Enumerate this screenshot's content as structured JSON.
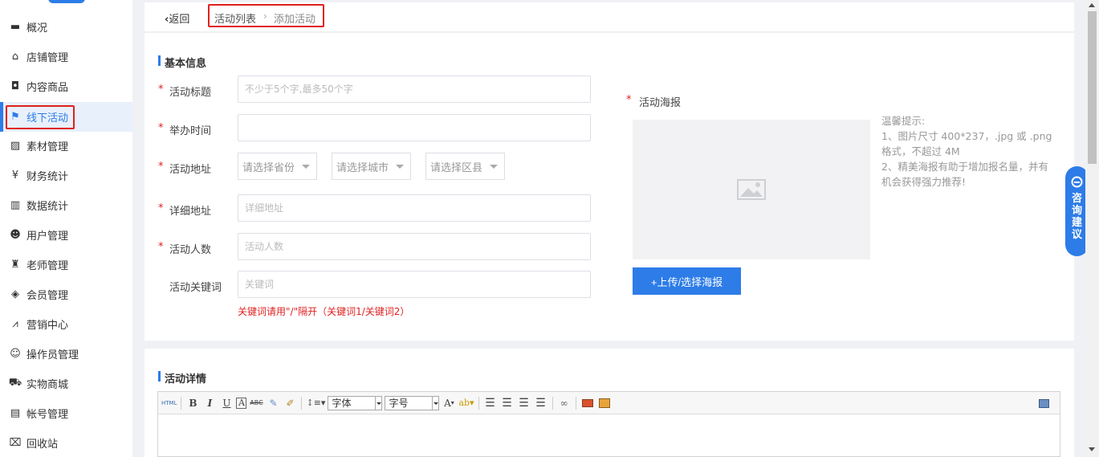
{
  "sidebar": {
    "items": [
      {
        "label": "概况",
        "icon": "overview-icon",
        "glyph": "▬"
      },
      {
        "label": "店铺管理",
        "icon": "shop-icon",
        "glyph": "⌂"
      },
      {
        "label": "内容商品",
        "icon": "bag-icon",
        "glyph": "◘"
      },
      {
        "label": "线下活动",
        "icon": "flag-icon",
        "glyph": "⚑"
      },
      {
        "label": "素材管理",
        "icon": "image-icon",
        "glyph": "▨"
      },
      {
        "label": "财务统计",
        "icon": "yen-icon",
        "glyph": "¥"
      },
      {
        "label": "数据统计",
        "icon": "bar-chart-icon",
        "glyph": "▥"
      },
      {
        "label": "用户管理",
        "icon": "user-icon",
        "glyph": "☻"
      },
      {
        "label": "老师管理",
        "icon": "teacher-icon",
        "glyph": "♜"
      },
      {
        "label": "会员管理",
        "icon": "diamond-icon",
        "glyph": "◈"
      },
      {
        "label": "营销中心",
        "icon": "trend-icon",
        "glyph": "⩘"
      },
      {
        "label": "操作员管理",
        "icon": "operator-icon",
        "glyph": "☺"
      },
      {
        "label": "实物商城",
        "icon": "cart-icon",
        "glyph": "⛟"
      },
      {
        "label": "帐号管理",
        "icon": "id-card-icon",
        "glyph": "▤"
      },
      {
        "label": "回收站",
        "icon": "trash-icon",
        "glyph": "⌧"
      }
    ],
    "active_index": 3
  },
  "header": {
    "back_label": "返回",
    "breadcrumb_parent": "活动列表",
    "breadcrumb_current": "添加活动",
    "breadcrumb_sep": "›"
  },
  "basic_info": {
    "title": "基本信息",
    "fields": {
      "activity_title": {
        "label": "活动标题",
        "placeholder": "不少于5个字,最多50个字",
        "value": ""
      },
      "hold_time": {
        "label": "举办时间",
        "placeholder": "",
        "value": ""
      },
      "address": {
        "label": "活动地址",
        "province": "请选择省份",
        "city": "请选择城市",
        "district": "请选择区县"
      },
      "detail_address": {
        "label": "详细地址",
        "placeholder": "详细地址",
        "value": ""
      },
      "participants": {
        "label": "活动人数",
        "placeholder": "活动人数",
        "value": ""
      },
      "keywords": {
        "label": "活动关键词",
        "placeholder": "关键词",
        "value": ""
      }
    },
    "keyword_hint": "关键词请用\"/\"隔开（关键词1/关键词2）",
    "required_mark": "*",
    "poster": {
      "label": "活动海报",
      "upload_label": "+上传/选择海报",
      "tips": [
        "温馨提示:",
        "1、图片尺寸 400*237，.jpg 或 .png",
        "格式，不超过 4M",
        "2、精美海报有助于增加报名量，并有",
        "机会获得强力推荐!"
      ]
    }
  },
  "feedback": {
    "label": "咨询建议"
  },
  "detail": {
    "title": "活动详情",
    "toolbar": {
      "html": "HTML",
      "bold": "B",
      "italic": "I",
      "underline": "U",
      "font_border": "A",
      "strike": "ABC",
      "font_family": "字体",
      "font_size": "字号",
      "font_color": "A"
    }
  },
  "colors": {
    "accent": "#2d7ce8",
    "required": "#e02020",
    "highlight_box": "#e02020"
  }
}
